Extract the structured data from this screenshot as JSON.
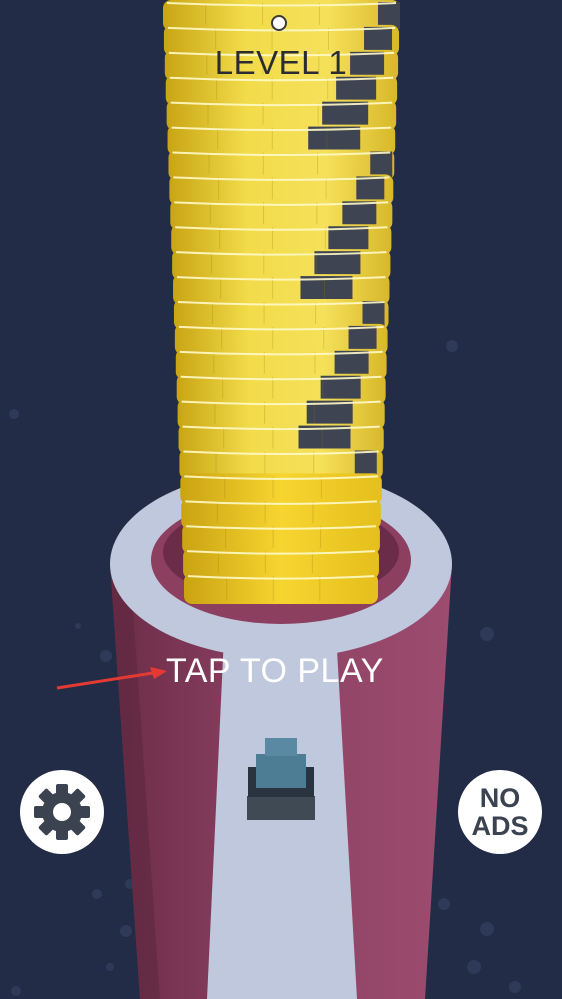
{
  "hud": {
    "level_label": "LEVEL 1"
  },
  "prompt": {
    "tap_label": "TAP TO PLAY"
  },
  "buttons": {
    "settings": {
      "icon": "gear-icon"
    },
    "no_ads": {
      "line1": "NO",
      "line2": "ADS"
    }
  },
  "colors": {
    "background": "#222c47",
    "stack_yellow": "#f2d93a",
    "stack_dark": "#3e4452",
    "pillar_pink": "#8c3f5f",
    "path_light": "#bfc8dc",
    "cannon": "#4d7c95"
  }
}
